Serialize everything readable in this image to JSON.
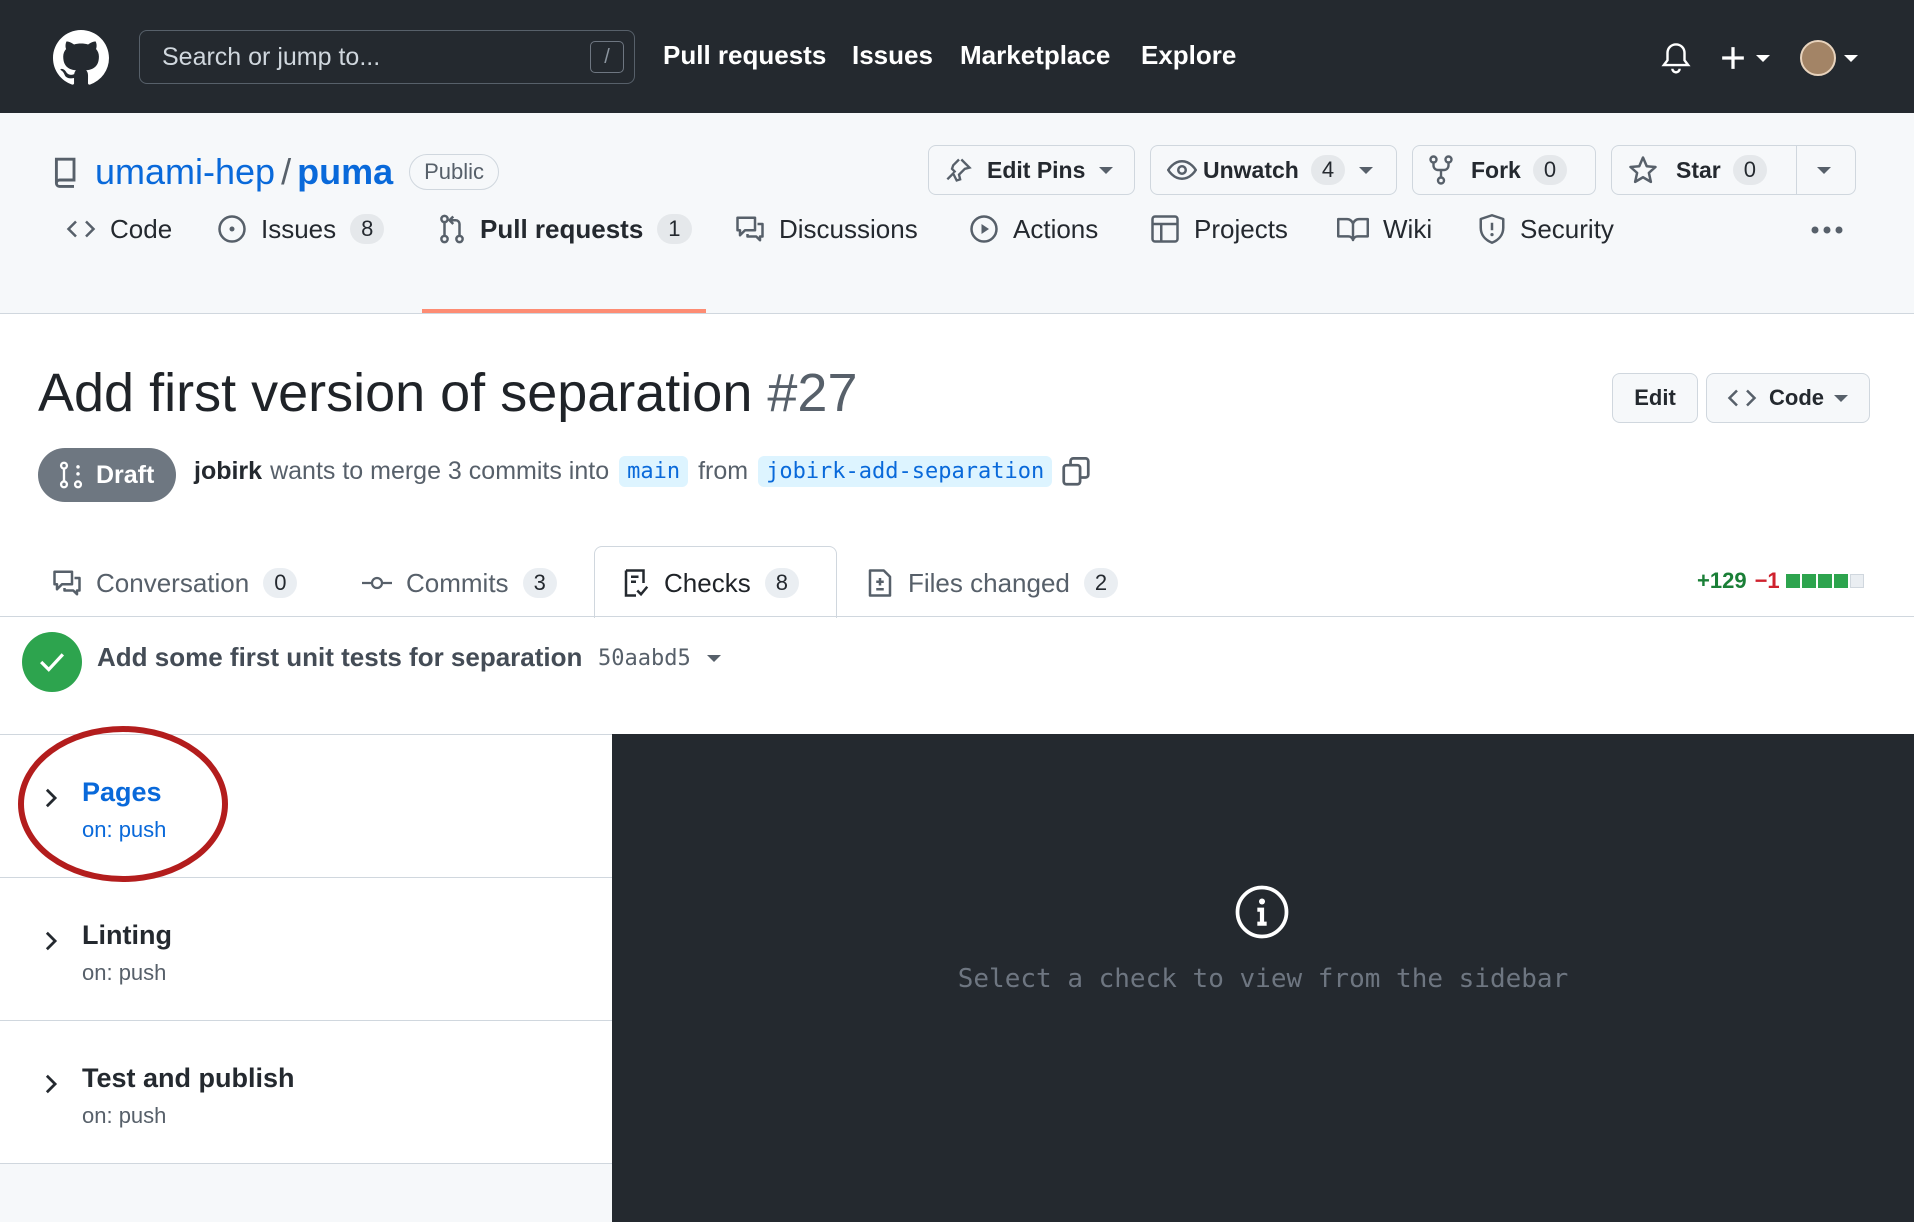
{
  "topnav": {
    "search_placeholder": "Search or jump to...",
    "search_shortcut": "/",
    "links": [
      "Pull requests",
      "Issues",
      "Marketplace",
      "Explore"
    ]
  },
  "repo": {
    "owner": "umami-hep",
    "separator": "/",
    "name": "puma",
    "visibility": "Public",
    "edit_pins_label": "Edit Pins",
    "unwatch_label": "Unwatch",
    "unwatch_count": "4",
    "fork_label": "Fork",
    "fork_count": "0",
    "star_label": "Star",
    "star_count": "0"
  },
  "repo_tabs": [
    {
      "label": "Code",
      "count": ""
    },
    {
      "label": "Issues",
      "count": "8"
    },
    {
      "label": "Pull requests",
      "count": "1"
    },
    {
      "label": "Discussions",
      "count": ""
    },
    {
      "label": "Actions",
      "count": ""
    },
    {
      "label": "Projects",
      "count": ""
    },
    {
      "label": "Wiki",
      "count": ""
    },
    {
      "label": "Security",
      "count": ""
    }
  ],
  "pr": {
    "title": "Add first version of separation",
    "number": "#27",
    "edit_label": "Edit",
    "code_label": "Code",
    "state": "Draft",
    "author": "jobirk",
    "meta_text": "wants to merge 3 commits into",
    "base_branch": "main",
    "from_text": "from",
    "head_branch": "jobirk-add-separation"
  },
  "pr_tabs": [
    {
      "label": "Conversation",
      "count": "0"
    },
    {
      "label": "Commits",
      "count": "3"
    },
    {
      "label": "Checks",
      "count": "8"
    },
    {
      "label": "Files changed",
      "count": "2"
    }
  ],
  "diffstat": {
    "additions": "+129",
    "deletions": "−1"
  },
  "commit": {
    "message": "Add some first unit tests for separation",
    "sha": "50aabd5"
  },
  "workflows": [
    {
      "name": "Pages",
      "trigger": "on: push"
    },
    {
      "name": "Linting",
      "trigger": "on: push"
    },
    {
      "name": "Test and publish",
      "trigger": "on: push"
    }
  ],
  "panel": {
    "message": "Select a check to view from the sidebar"
  },
  "colors": {
    "accent": "#0969da",
    "success": "#2da44e",
    "underline": "#fd8c73",
    "annotation": "#b31d1d"
  }
}
